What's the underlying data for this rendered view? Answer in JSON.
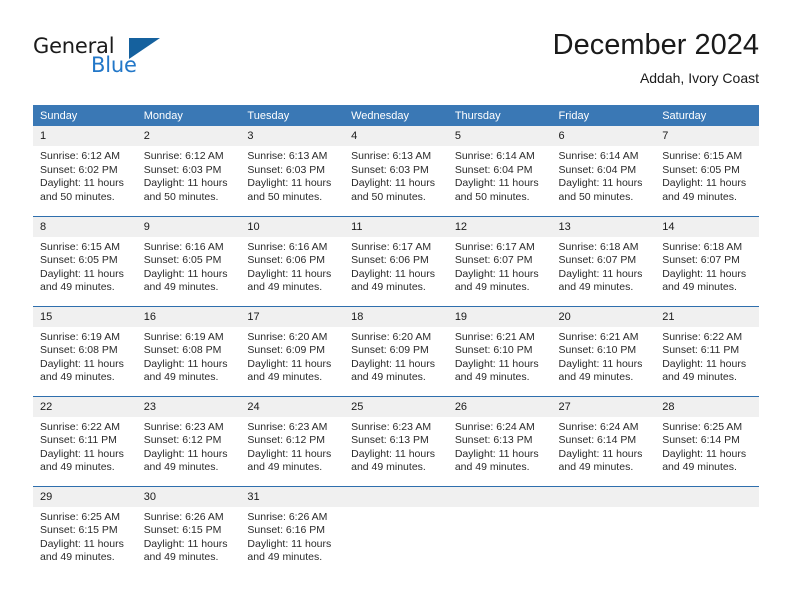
{
  "brand": {
    "name_primary": "General",
    "name_secondary": "Blue",
    "accent_color": "#2277c8",
    "triangle_color": "#15619e"
  },
  "header": {
    "title": "December 2024",
    "subtitle": "Addah, Ivory Coast"
  },
  "calendar": {
    "header_color": "#3a78b5",
    "daynum_background": "#f0f0f0",
    "weekday_headers": [
      "Sunday",
      "Monday",
      "Tuesday",
      "Wednesday",
      "Thursday",
      "Friday",
      "Saturday"
    ],
    "weeks": [
      [
        {
          "day": "1",
          "sunrise": "Sunrise: 6:12 AM",
          "sunset": "Sunset: 6:02 PM",
          "daylight": "Daylight: 11 hours and 50 minutes."
        },
        {
          "day": "2",
          "sunrise": "Sunrise: 6:12 AM",
          "sunset": "Sunset: 6:03 PM",
          "daylight": "Daylight: 11 hours and 50 minutes."
        },
        {
          "day": "3",
          "sunrise": "Sunrise: 6:13 AM",
          "sunset": "Sunset: 6:03 PM",
          "daylight": "Daylight: 11 hours and 50 minutes."
        },
        {
          "day": "4",
          "sunrise": "Sunrise: 6:13 AM",
          "sunset": "Sunset: 6:03 PM",
          "daylight": "Daylight: 11 hours and 50 minutes."
        },
        {
          "day": "5",
          "sunrise": "Sunrise: 6:14 AM",
          "sunset": "Sunset: 6:04 PM",
          "daylight": "Daylight: 11 hours and 50 minutes."
        },
        {
          "day": "6",
          "sunrise": "Sunrise: 6:14 AM",
          "sunset": "Sunset: 6:04 PM",
          "daylight": "Daylight: 11 hours and 50 minutes."
        },
        {
          "day": "7",
          "sunrise": "Sunrise: 6:15 AM",
          "sunset": "Sunset: 6:05 PM",
          "daylight": "Daylight: 11 hours and 49 minutes."
        }
      ],
      [
        {
          "day": "8",
          "sunrise": "Sunrise: 6:15 AM",
          "sunset": "Sunset: 6:05 PM",
          "daylight": "Daylight: 11 hours and 49 minutes."
        },
        {
          "day": "9",
          "sunrise": "Sunrise: 6:16 AM",
          "sunset": "Sunset: 6:05 PM",
          "daylight": "Daylight: 11 hours and 49 minutes."
        },
        {
          "day": "10",
          "sunrise": "Sunrise: 6:16 AM",
          "sunset": "Sunset: 6:06 PM",
          "daylight": "Daylight: 11 hours and 49 minutes."
        },
        {
          "day": "11",
          "sunrise": "Sunrise: 6:17 AM",
          "sunset": "Sunset: 6:06 PM",
          "daylight": "Daylight: 11 hours and 49 minutes."
        },
        {
          "day": "12",
          "sunrise": "Sunrise: 6:17 AM",
          "sunset": "Sunset: 6:07 PM",
          "daylight": "Daylight: 11 hours and 49 minutes."
        },
        {
          "day": "13",
          "sunrise": "Sunrise: 6:18 AM",
          "sunset": "Sunset: 6:07 PM",
          "daylight": "Daylight: 11 hours and 49 minutes."
        },
        {
          "day": "14",
          "sunrise": "Sunrise: 6:18 AM",
          "sunset": "Sunset: 6:07 PM",
          "daylight": "Daylight: 11 hours and 49 minutes."
        }
      ],
      [
        {
          "day": "15",
          "sunrise": "Sunrise: 6:19 AM",
          "sunset": "Sunset: 6:08 PM",
          "daylight": "Daylight: 11 hours and 49 minutes."
        },
        {
          "day": "16",
          "sunrise": "Sunrise: 6:19 AM",
          "sunset": "Sunset: 6:08 PM",
          "daylight": "Daylight: 11 hours and 49 minutes."
        },
        {
          "day": "17",
          "sunrise": "Sunrise: 6:20 AM",
          "sunset": "Sunset: 6:09 PM",
          "daylight": "Daylight: 11 hours and 49 minutes."
        },
        {
          "day": "18",
          "sunrise": "Sunrise: 6:20 AM",
          "sunset": "Sunset: 6:09 PM",
          "daylight": "Daylight: 11 hours and 49 minutes."
        },
        {
          "day": "19",
          "sunrise": "Sunrise: 6:21 AM",
          "sunset": "Sunset: 6:10 PM",
          "daylight": "Daylight: 11 hours and 49 minutes."
        },
        {
          "day": "20",
          "sunrise": "Sunrise: 6:21 AM",
          "sunset": "Sunset: 6:10 PM",
          "daylight": "Daylight: 11 hours and 49 minutes."
        },
        {
          "day": "21",
          "sunrise": "Sunrise: 6:22 AM",
          "sunset": "Sunset: 6:11 PM",
          "daylight": "Daylight: 11 hours and 49 minutes."
        }
      ],
      [
        {
          "day": "22",
          "sunrise": "Sunrise: 6:22 AM",
          "sunset": "Sunset: 6:11 PM",
          "daylight": "Daylight: 11 hours and 49 minutes."
        },
        {
          "day": "23",
          "sunrise": "Sunrise: 6:23 AM",
          "sunset": "Sunset: 6:12 PM",
          "daylight": "Daylight: 11 hours and 49 minutes."
        },
        {
          "day": "24",
          "sunrise": "Sunrise: 6:23 AM",
          "sunset": "Sunset: 6:12 PM",
          "daylight": "Daylight: 11 hours and 49 minutes."
        },
        {
          "day": "25",
          "sunrise": "Sunrise: 6:23 AM",
          "sunset": "Sunset: 6:13 PM",
          "daylight": "Daylight: 11 hours and 49 minutes."
        },
        {
          "day": "26",
          "sunrise": "Sunrise: 6:24 AM",
          "sunset": "Sunset: 6:13 PM",
          "daylight": "Daylight: 11 hours and 49 minutes."
        },
        {
          "day": "27",
          "sunrise": "Sunrise: 6:24 AM",
          "sunset": "Sunset: 6:14 PM",
          "daylight": "Daylight: 11 hours and 49 minutes."
        },
        {
          "day": "28",
          "sunrise": "Sunrise: 6:25 AM",
          "sunset": "Sunset: 6:14 PM",
          "daylight": "Daylight: 11 hours and 49 minutes."
        }
      ],
      [
        {
          "day": "29",
          "sunrise": "Sunrise: 6:25 AM",
          "sunset": "Sunset: 6:15 PM",
          "daylight": "Daylight: 11 hours and 49 minutes."
        },
        {
          "day": "30",
          "sunrise": "Sunrise: 6:26 AM",
          "sunset": "Sunset: 6:15 PM",
          "daylight": "Daylight: 11 hours and 49 minutes."
        },
        {
          "day": "31",
          "sunrise": "Sunrise: 6:26 AM",
          "sunset": "Sunset: 6:16 PM",
          "daylight": "Daylight: 11 hours and 49 minutes."
        },
        {
          "day": "",
          "sunrise": "",
          "sunset": "",
          "daylight": ""
        },
        {
          "day": "",
          "sunrise": "",
          "sunset": "",
          "daylight": ""
        },
        {
          "day": "",
          "sunrise": "",
          "sunset": "",
          "daylight": ""
        },
        {
          "day": "",
          "sunrise": "",
          "sunset": "",
          "daylight": ""
        }
      ]
    ]
  }
}
